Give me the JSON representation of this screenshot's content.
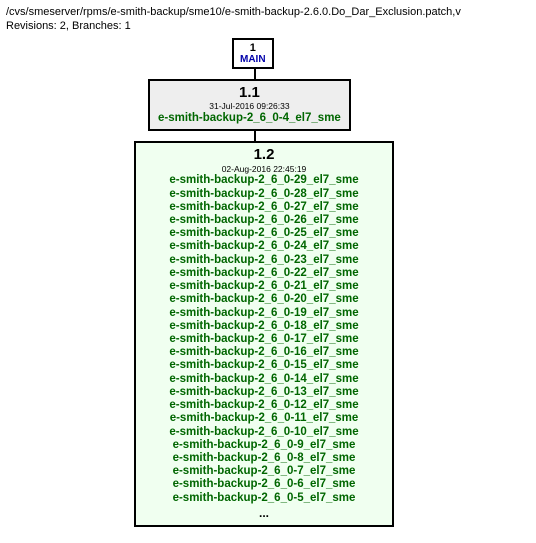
{
  "header": {
    "path": "/cvs/smeserver/rpms/e-smith-backup/sme10/e-smith-backup-2.6.0.Do_Dar_Exclusion.patch,v",
    "info": "Revisions: 2, Branches: 1"
  },
  "branch": {
    "number": "1",
    "name": "MAIN"
  },
  "rev11": {
    "number": "1.1",
    "date": "31-Jul-2016 09:26:33",
    "tag": "e-smith-backup-2_6_0-4_el7_sme"
  },
  "rev12": {
    "number": "1.2",
    "date": "02-Aug-2016 22:45:19",
    "tags": [
      "e-smith-backup-2_6_0-29_el7_sme",
      "e-smith-backup-2_6_0-28_el7_sme",
      "e-smith-backup-2_6_0-27_el7_sme",
      "e-smith-backup-2_6_0-26_el7_sme",
      "e-smith-backup-2_6_0-25_el7_sme",
      "e-smith-backup-2_6_0-24_el7_sme",
      "e-smith-backup-2_6_0-23_el7_sme",
      "e-smith-backup-2_6_0-22_el7_sme",
      "e-smith-backup-2_6_0-21_el7_sme",
      "e-smith-backup-2_6_0-20_el7_sme",
      "e-smith-backup-2_6_0-19_el7_sme",
      "e-smith-backup-2_6_0-18_el7_sme",
      "e-smith-backup-2_6_0-17_el7_sme",
      "e-smith-backup-2_6_0-16_el7_sme",
      "e-smith-backup-2_6_0-15_el7_sme",
      "e-smith-backup-2_6_0-14_el7_sme",
      "e-smith-backup-2_6_0-13_el7_sme",
      "e-smith-backup-2_6_0-12_el7_sme",
      "e-smith-backup-2_6_0-11_el7_sme",
      "e-smith-backup-2_6_0-10_el7_sme",
      "e-smith-backup-2_6_0-9_el7_sme",
      "e-smith-backup-2_6_0-8_el7_sme",
      "e-smith-backup-2_6_0-7_el7_sme",
      "e-smith-backup-2_6_0-6_el7_sme",
      "e-smith-backup-2_6_0-5_el7_sme"
    ],
    "more": "..."
  }
}
